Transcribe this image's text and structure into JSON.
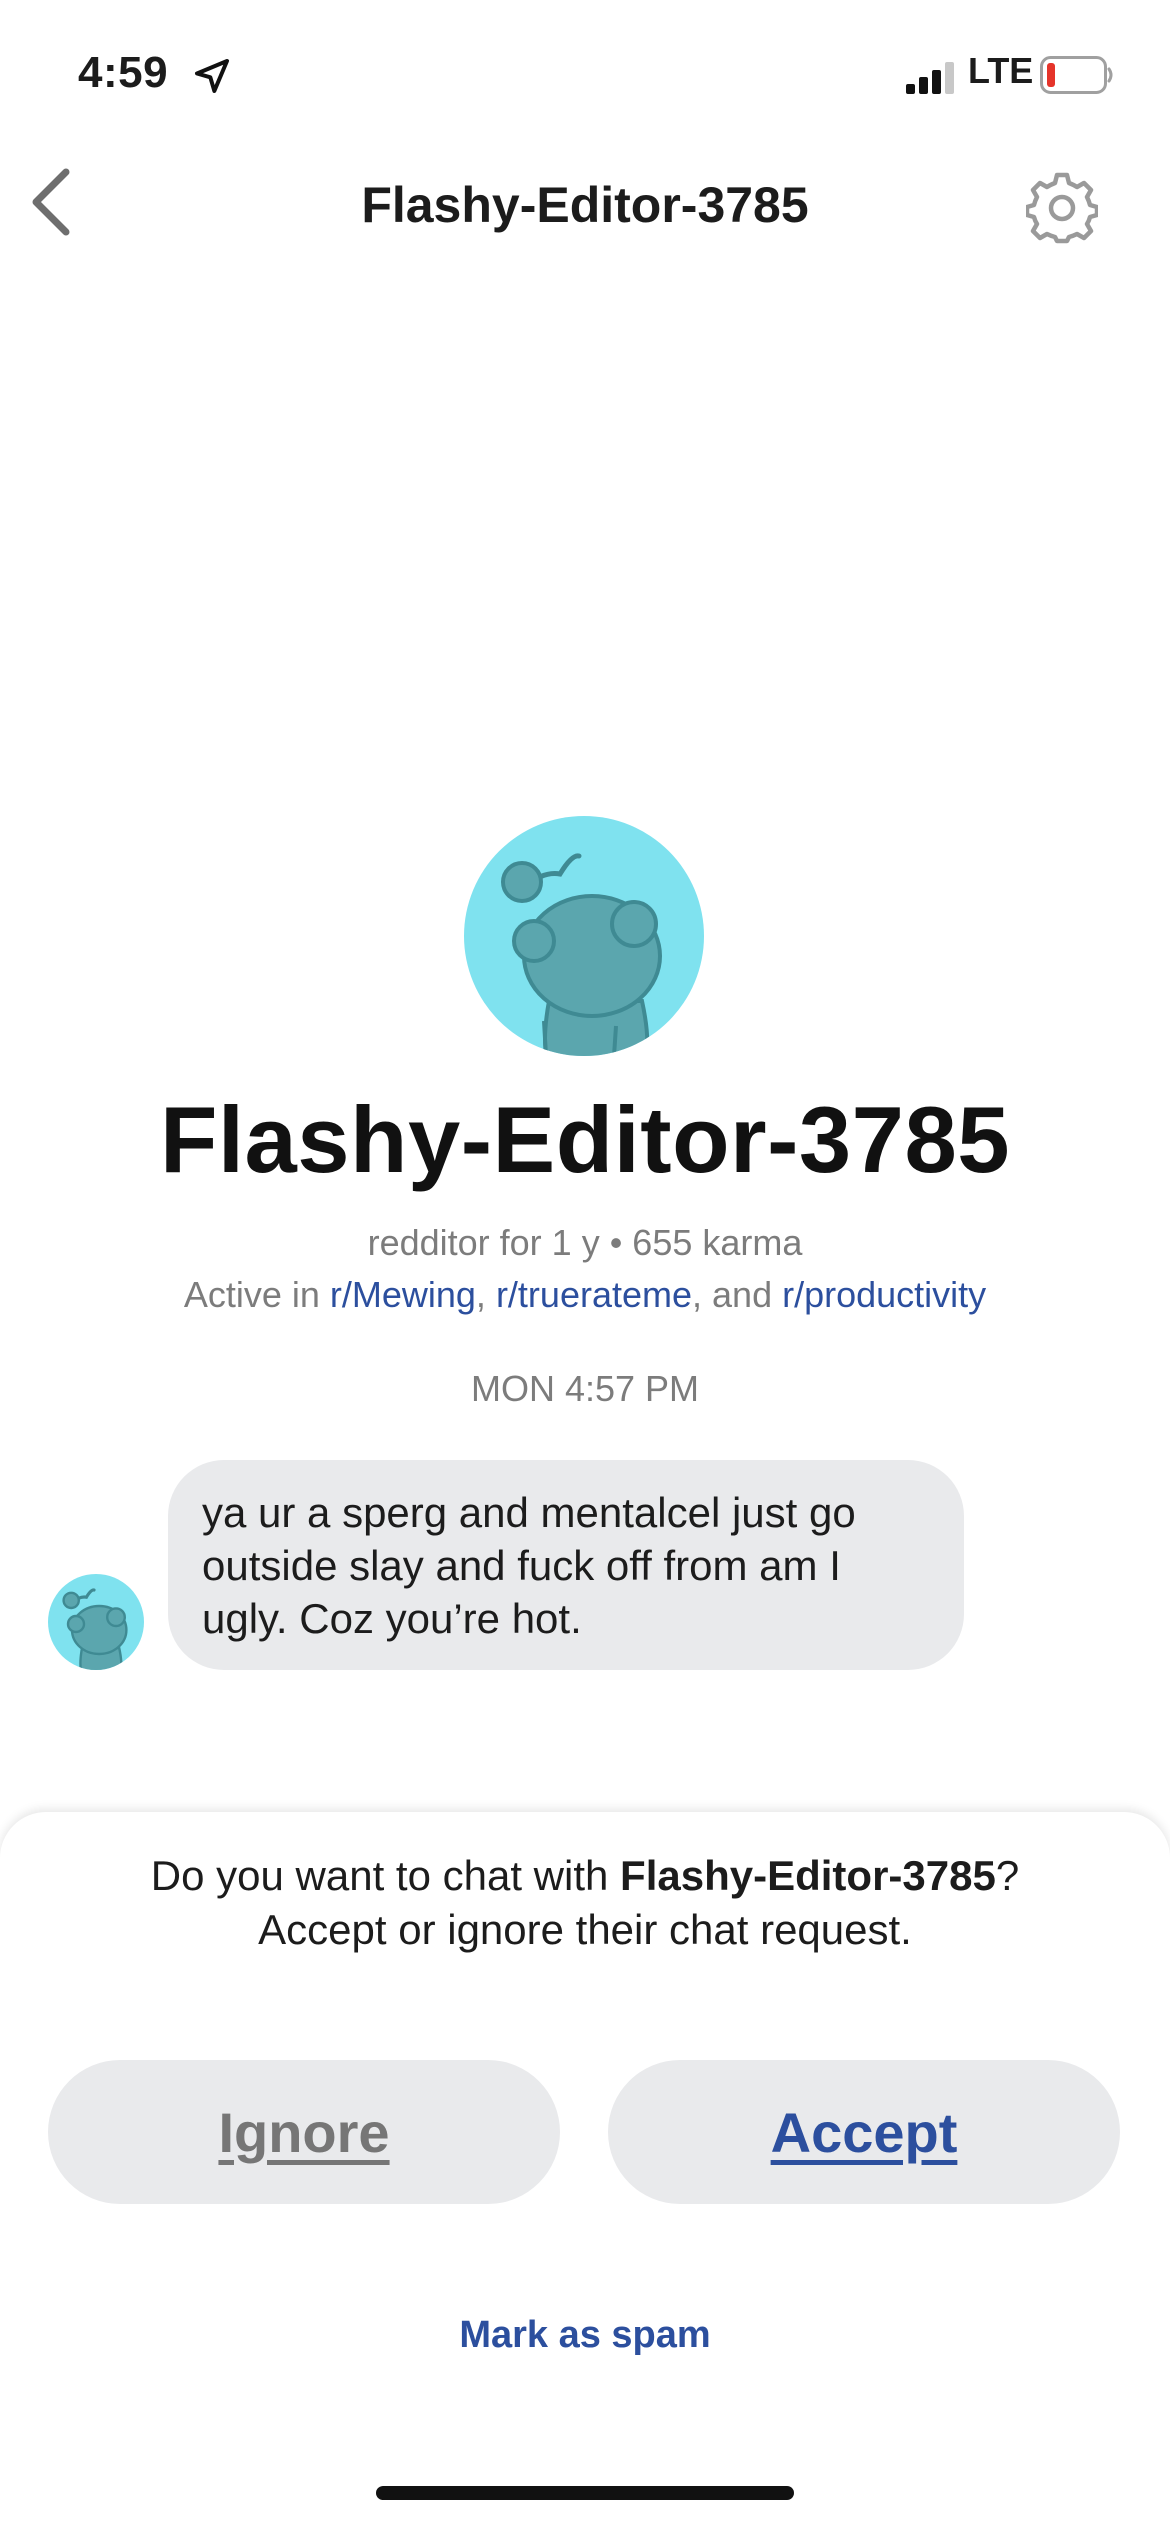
{
  "status_bar": {
    "time": "4:59",
    "network": "LTE",
    "icons": [
      "location-arrow-icon",
      "cellular-signal-icon",
      "battery-low-icon"
    ]
  },
  "nav": {
    "title": "Flashy-Editor-3785",
    "icons": [
      "back-chevron-icon",
      "settings-gear-icon"
    ]
  },
  "profile": {
    "name": "Flashy-Editor-3785",
    "meta_line": "redditor for 1 y • 655 karma",
    "active_prefix": "Active in ",
    "communities": [
      "r/Mewing",
      "r/truerateme",
      "r/productivity"
    ],
    "sep_comma": ", ",
    "sep_and": ", and ",
    "avatar_bg_color": "#7fe2ef",
    "avatar_icon": "snoo-avatar-icon"
  },
  "chat": {
    "timestamp": "MON 4:57 PM",
    "messages": [
      {
        "text": "ya ur a sperg and mentalcel just go outside slay and fuck off from am I ugly. Coz you’re hot."
      }
    ]
  },
  "request_sheet": {
    "prompt_prefix": "Do you want to chat with ",
    "prompt_name": "Flashy-Editor-3785",
    "prompt_suffix": "?",
    "prompt_line2": "Accept or ignore their chat request.",
    "ignore_label": "Ignore",
    "accept_label": "Accept",
    "spam_label": "Mark as spam"
  },
  "colors": {
    "link_blue": "#2c4f9e",
    "bubble_gray": "#e9eaec",
    "secondary_text": "#7c7c7c",
    "battery_red": "#e5342a"
  }
}
